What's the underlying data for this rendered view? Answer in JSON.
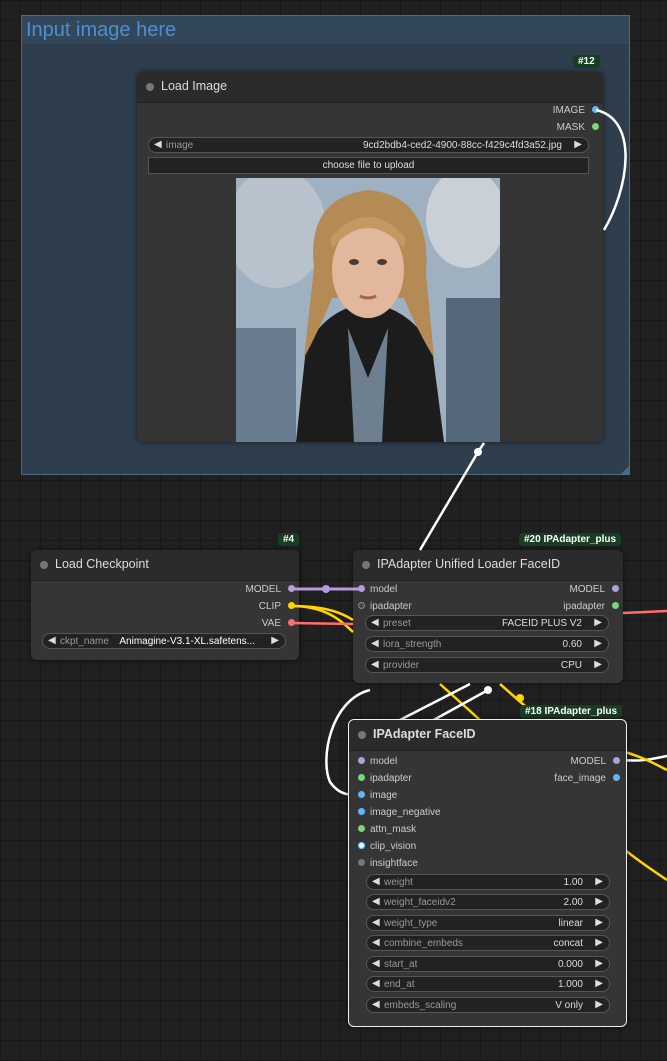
{
  "group": {
    "title": "Input image here"
  },
  "load_image": {
    "id": "#12",
    "title": "Load Image",
    "outputs": [
      "IMAGE",
      "MASK"
    ],
    "image_widget": {
      "name": "image",
      "value": "9cd2bdb4-ced2-4900-88cc-f429c4fd3a52.jpg"
    },
    "upload_label": "choose file to upload"
  },
  "load_checkpoint": {
    "id": "#4",
    "title": "Load Checkpoint",
    "outputs": [
      "MODEL",
      "CLIP",
      "VAE"
    ],
    "ckpt_widget": {
      "name": "ckpt_name",
      "value": "Animagine-V3.1-XL.safetens..."
    }
  },
  "unified_loader": {
    "id": "#20 IPAdapter_plus",
    "title": "IPAdapter Unified Loader FaceID",
    "inputs": [
      "model",
      "ipadapter"
    ],
    "outputs": [
      "MODEL",
      "ipadapter"
    ],
    "widgets": [
      {
        "name": "preset",
        "value": "FACEID PLUS V2"
      },
      {
        "name": "lora_strength",
        "value": "0.60"
      },
      {
        "name": "provider",
        "value": "CPU"
      }
    ]
  },
  "faceid": {
    "id": "#18 IPAdapter_plus",
    "title": "IPAdapter FaceID",
    "inputs": [
      "model",
      "ipadapter",
      "image",
      "image_negative",
      "attn_mask",
      "clip_vision",
      "insightface"
    ],
    "outputs": [
      "MODEL",
      "face_image"
    ],
    "widgets": [
      {
        "name": "weight",
        "value": "1.00"
      },
      {
        "name": "weight_faceidv2",
        "value": "2.00"
      },
      {
        "name": "weight_type",
        "value": "linear"
      },
      {
        "name": "combine_embeds",
        "value": "concat"
      },
      {
        "name": "start_at",
        "value": "0.000"
      },
      {
        "name": "end_at",
        "value": "1.000"
      },
      {
        "name": "embeds_scaling",
        "value": "V only"
      }
    ]
  },
  "colors": {
    "model": "#b39ddb",
    "clip": "#ffd500",
    "vae": "#ff6e6e",
    "image": "#64b5f6",
    "ipadapter": "#7bd67b",
    "badge_bg": "#173d22"
  }
}
